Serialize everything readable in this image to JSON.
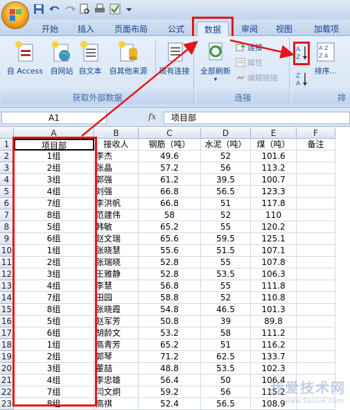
{
  "tabs": [
    "开始",
    "插入",
    "页面布局",
    "公式",
    "数据",
    "审阅",
    "视图",
    "加载项"
  ],
  "active_tab": "数据",
  "ribbon": {
    "external_group": {
      "label": "获取外部数据",
      "buttons": [
        "自 Access",
        "自网站",
        "自文本",
        "自其他来源",
        "现有连接"
      ]
    },
    "connections_group": {
      "label": "连接",
      "refresh_all": "全部刷新",
      "connections": "连接",
      "properties": "属性",
      "edit_links": "编辑链接"
    },
    "sort_group": {
      "label": "排",
      "sort": "排序..."
    }
  },
  "formula_bar": {
    "name_box": "A1",
    "fx": "fx",
    "value": "项目部"
  },
  "columns": [
    "A",
    "B",
    "C",
    "D",
    "E",
    "F"
  ],
  "headers": [
    "项目部",
    "接收人",
    "钢筋（吨）",
    "水泥（吨）",
    "煤（吨）",
    "备注"
  ],
  "rows": [
    [
      "1组",
      "李杰",
      "49.6",
      "52",
      "101.6",
      ""
    ],
    [
      "2组",
      "张晶",
      "57.2",
      "56",
      "113.2",
      ""
    ],
    [
      "3组",
      "郭强",
      "61.2",
      "39.5",
      "100.7",
      ""
    ],
    [
      "4组",
      "刘强",
      "66.8",
      "56.5",
      "123.3",
      ""
    ],
    [
      "7组",
      "李洪帆",
      "66.8",
      "51",
      "117.8",
      ""
    ],
    [
      "8组",
      "范建伟",
      "58",
      "52",
      "110",
      ""
    ],
    [
      "5组",
      "韩敏",
      "65.2",
      "55",
      "120.2",
      ""
    ],
    [
      "6组",
      "赵文瑞",
      "65.6",
      "59.5",
      "125.1",
      ""
    ],
    [
      "1组",
      "张晓慧",
      "55.6",
      "51.5",
      "107.1",
      ""
    ],
    [
      "2组",
      "张瑞晓",
      "52.8",
      "55",
      "107.8",
      ""
    ],
    [
      "3组",
      "王雅静",
      "52.8",
      "53.5",
      "106.3",
      ""
    ],
    [
      "4组",
      "李慧",
      "56.8",
      "55",
      "111.8",
      ""
    ],
    [
      "7组",
      "田园",
      "58.8",
      "52",
      "110.8",
      ""
    ],
    [
      "8组",
      "张晓霞",
      "54.8",
      "46.5",
      "101.3",
      ""
    ],
    [
      "5组",
      "赵军芳",
      "50.8",
      "39",
      "89.8",
      ""
    ],
    [
      "6组",
      "胡龄文",
      "53.2",
      "58",
      "111.2",
      ""
    ],
    [
      "1组",
      "高青芳",
      "65.2",
      "51",
      "116.2",
      ""
    ],
    [
      "2组",
      "郭琴",
      "71.2",
      "62.5",
      "133.7",
      ""
    ],
    [
      "3组",
      "董喆",
      "48.8",
      "53.5",
      "102.3",
      ""
    ],
    [
      "4组",
      "李忠雄",
      "56.4",
      "50",
      "106.4",
      ""
    ],
    [
      "7组",
      "闫文炯",
      "59.2",
      "56",
      "115.2",
      ""
    ],
    [
      "8组",
      "高祺",
      "52.4",
      "56.5",
      "108.9",
      ""
    ]
  ],
  "watermark": "我爱技术网",
  "watermark_sub": "www.5aixue.com",
  "colors": {
    "highlight": "#e8121a",
    "ribbon": "#dbe7f6",
    "text": "#15428b"
  }
}
